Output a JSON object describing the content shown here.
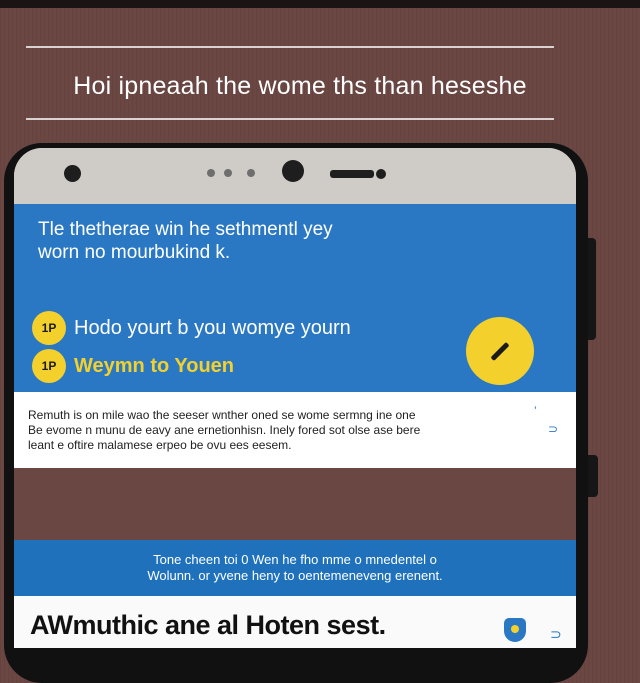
{
  "banner": {
    "title": "Hoi ipneaah the wome ths than heseshe"
  },
  "hero": {
    "text_line1": "Tle thetherae win he sethmentl yey",
    "text_line2": "worn no mourbukind k.",
    "items": [
      {
        "badge": "1P",
        "label": "Hodo yourt b you womye yourn"
      },
      {
        "badge": "1P",
        "label": "Weymn to Youen"
      }
    ],
    "fab_icon": "pencil-icon"
  },
  "info": {
    "lines": [
      "Remuth is on mile wao the seeser wnther oned se wome sermng ine one",
      "Be evome n munu de eavy ane ernetionhisn. Inely fored sot olse ase bere",
      "leant e oftire malamese erpeo be ovu ees eesem."
    ],
    "mark1": "’",
    "mark2": "⊃"
  },
  "promo": {
    "line1": "Tone cheen toi 0 Wen he fho mme o mnedentel o",
    "line2": "Wolunn. or yvene heny to oentemeneveng erenent."
  },
  "bottom": {
    "title": "AWmuthic ane al Hoten sest.",
    "icon": "shield-icon",
    "mark": "⊃"
  },
  "colors": {
    "primary_blue": "#2a78c3",
    "accent_yellow": "#f4d02c",
    "background_brown": "#6b4744"
  }
}
